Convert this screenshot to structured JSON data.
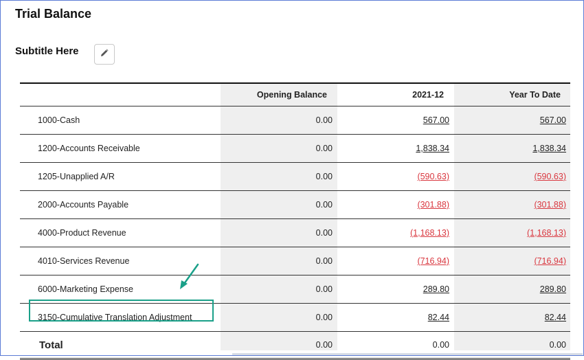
{
  "page": {
    "title": "Trial Balance",
    "subtitle": "Subtitle Here",
    "edit_icon": "pencil-icon"
  },
  "table": {
    "columns": [
      "",
      "Opening Balance",
      "2021-12",
      "Year To Date"
    ],
    "rows": [
      {
        "account": "1000-Cash",
        "opening": "0.00",
        "period": "567.00",
        "ytd": "567.00"
      },
      {
        "account": "1200-Accounts Receivable",
        "opening": "0.00",
        "period": "1,838.34",
        "ytd": "1,838.34"
      },
      {
        "account": "1205-Unapplied A/R",
        "opening": "0.00",
        "period": "(590.63)",
        "ytd": "(590.63)"
      },
      {
        "account": "2000-Accounts Payable",
        "opening": "0.00",
        "period": "(301.88)",
        "ytd": "(301.88)"
      },
      {
        "account": "4000-Product Revenue",
        "opening": "0.00",
        "period": "(1,168.13)",
        "ytd": "(1,168.13)"
      },
      {
        "account": "4010-Services Revenue",
        "opening": "0.00",
        "period": "(716.94)",
        "ytd": "(716.94)"
      },
      {
        "account": "6000-Marketing Expense",
        "opening": "0.00",
        "period": "289.80",
        "ytd": "289.80"
      },
      {
        "account": "3150-Cumulative Translation Adjustment",
        "opening": "0.00",
        "period": "82.44",
        "ytd": "82.44"
      }
    ],
    "total": {
      "label": "Total",
      "opening": "0.00",
      "period": "0.00",
      "ytd": "0.00"
    }
  },
  "colors": {
    "negative": "#d9363e",
    "highlight": "#1aa089",
    "frame": "#5b7bd5"
  }
}
